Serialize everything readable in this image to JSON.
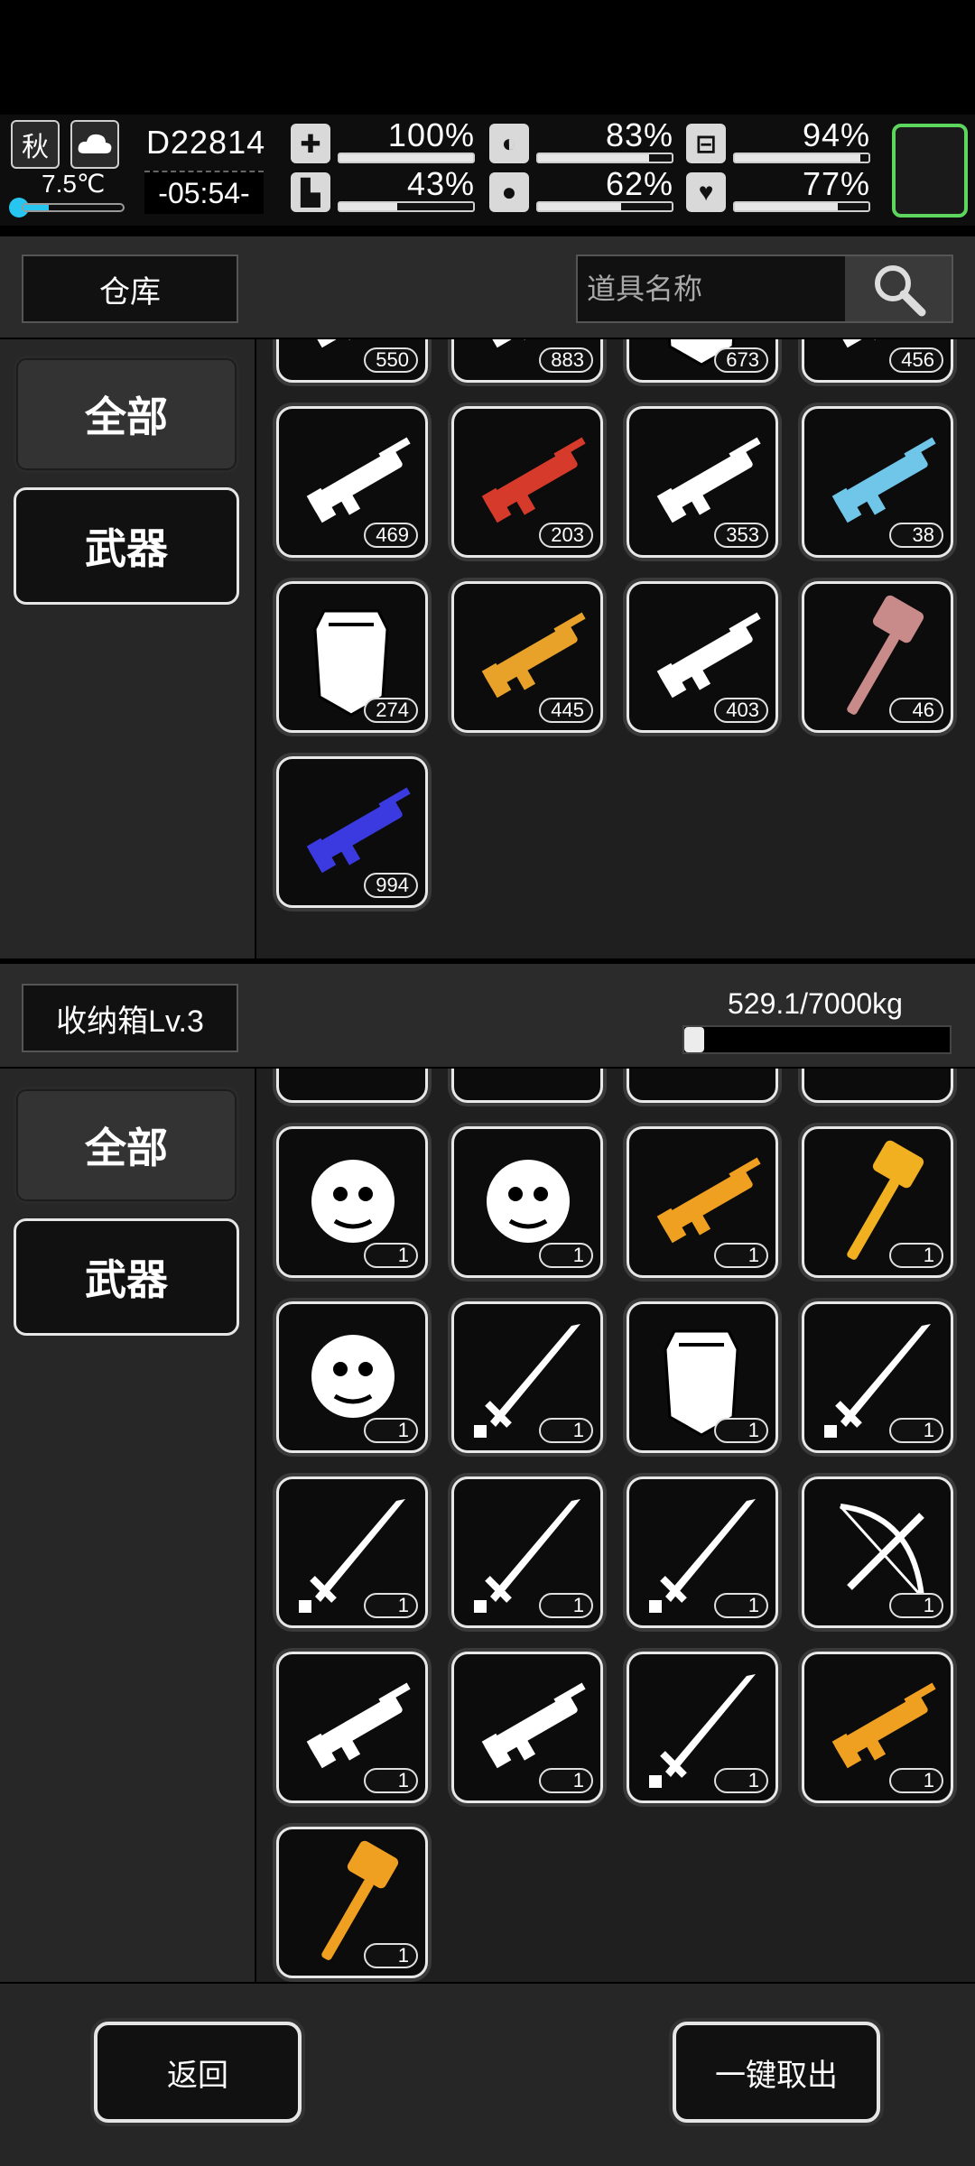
{
  "status": {
    "season": "秋",
    "weather_icon": "cloud-icon",
    "temperature": "7.5℃",
    "day": "D22814",
    "time": "-05:54-",
    "stats": [
      {
        "icon": "medkit-icon",
        "value": "100%",
        "level": 100
      },
      {
        "icon": "stomach-icon",
        "value": "83%",
        "level": 83
      },
      {
        "icon": "pill-icon",
        "value": "94%",
        "level": 94
      },
      {
        "icon": "boot-icon",
        "value": "43%",
        "level": 43
      },
      {
        "icon": "water-drop-icon",
        "value": "62%",
        "level": 62
      },
      {
        "icon": "heart-icon",
        "value": "77%",
        "level": 77
      }
    ]
  },
  "warehouse": {
    "title": "仓库",
    "search_placeholder": "道具名称",
    "categories": [
      "全部",
      "武器"
    ],
    "items": [
      {
        "name": "assault-rifle",
        "count": "550",
        "color": "#ffffff"
      },
      {
        "name": "shotgun",
        "count": "883",
        "color": "#ffffff"
      },
      {
        "name": "riot-shield",
        "count": "673",
        "color": "#ffffff"
      },
      {
        "name": "launcher",
        "count": "456",
        "color": "#ffffff"
      },
      {
        "name": "rifle",
        "count": "469",
        "color": "#ffffff"
      },
      {
        "name": "red-shotgun",
        "count": "203",
        "color": "#d63a2a"
      },
      {
        "name": "grenade-launcher",
        "count": "353",
        "color": "#ffffff"
      },
      {
        "name": "ice-cannon",
        "count": "38",
        "color": "#6fc6e8"
      },
      {
        "name": "shield",
        "count": "274",
        "color": "#ffffff"
      },
      {
        "name": "gold-sniper",
        "count": "445",
        "color": "#e8a22a"
      },
      {
        "name": "rocket-launcher",
        "count": "403",
        "color": "#ffffff"
      },
      {
        "name": "hammer",
        "count": "46",
        "color": "#c98a8a"
      },
      {
        "name": "minigun",
        "count": "994",
        "color": "#3a3ae0"
      }
    ]
  },
  "storage": {
    "title": "收纳箱Lv.3",
    "weight": "529.1/7000kg",
    "weight_level": 7.6,
    "categories": [
      "全部",
      "武器"
    ],
    "items": [
      {
        "name": "medusa-head",
        "count": "1",
        "color": "#ffffff"
      },
      {
        "name": "pagoda",
        "count": "1",
        "color": "#ffffff"
      },
      {
        "name": "golden-dragon-cannon",
        "count": "1",
        "color": "#f0a020"
      },
      {
        "name": "golden-dragon-mace",
        "count": "1",
        "color": "#f0b020"
      },
      {
        "name": "gauntlet",
        "count": "1",
        "color": "#ffffff"
      },
      {
        "name": "scythe-whip",
        "count": "1",
        "color": "#ffffff"
      },
      {
        "name": "dragon-shield",
        "count": "1",
        "color": "#ffffff"
      },
      {
        "name": "crystal-spear",
        "count": "1",
        "color": "#ffffff"
      },
      {
        "name": "katana",
        "count": "1",
        "color": "#ffffff"
      },
      {
        "name": "ornate-spear",
        "count": "1",
        "color": "#ffffff"
      },
      {
        "name": "chainsaw-sword",
        "count": "1",
        "color": "#ffffff"
      },
      {
        "name": "crossbow",
        "count": "1",
        "color": "#ffffff"
      },
      {
        "name": "sniper-rifle",
        "count": "1",
        "color": "#ffffff"
      },
      {
        "name": "heavy-machine-gun",
        "count": "1",
        "color": "#ffffff"
      },
      {
        "name": "sword-and-instrument",
        "count": "1",
        "color": "#ffffff"
      },
      {
        "name": "golden-blaster",
        "count": "1",
        "color": "#f0a020"
      },
      {
        "name": "golden-dragon-hammer",
        "count": "1",
        "color": "#f0a020"
      }
    ]
  },
  "buttons": {
    "back": "返回",
    "take_all": "一键取出"
  }
}
